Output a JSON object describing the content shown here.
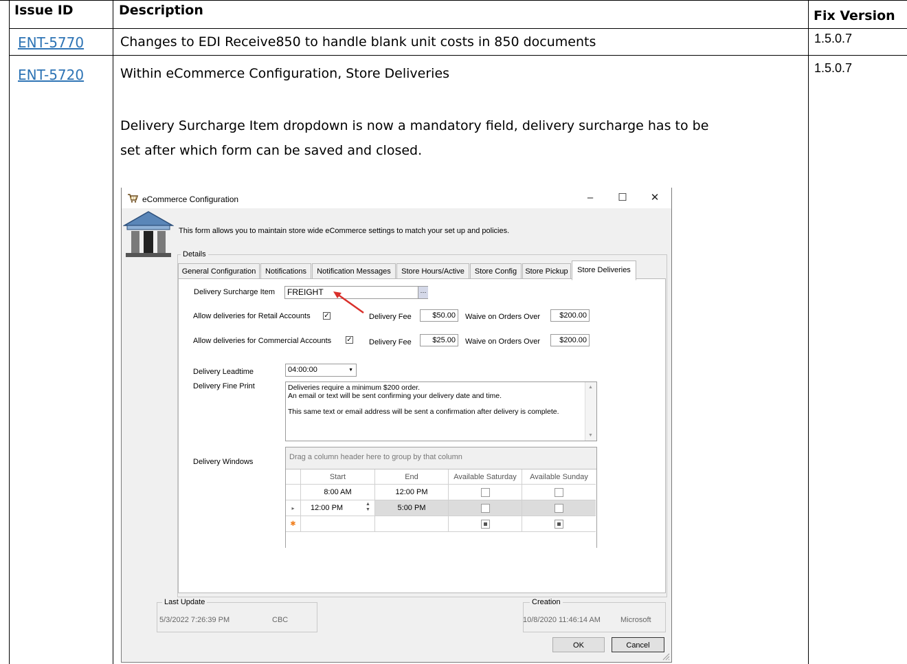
{
  "table": {
    "headers": {
      "issue": "Issue ID",
      "description": "Description",
      "fix": "Fix Version"
    },
    "rows": [
      {
        "issue": "ENT-5770",
        "description": "Changes to EDI Receive850 to handle blank unit costs in 850 documents",
        "fix": "1.5.0.7"
      },
      {
        "issue": "ENT-5720",
        "description_1": "Within eCommerce Configuration, Store Deliveries",
        "description_2": "Delivery Surcharge Item dropdown is now a mandatory field, delivery surcharge has to be",
        "description_3": "set after which form can be saved and closed.",
        "fix": "1.5.0.7"
      }
    ]
  },
  "dialog": {
    "title": "eCommerce Configuration",
    "controls": {
      "minimize": "–",
      "maximize": "☐",
      "close": "✕"
    },
    "intro": "This form allows you to maintain store wide eCommerce settings to match your set up and policies.",
    "details_label": "Details",
    "tabs": [
      "General Configuration",
      "Notifications",
      "Notification Messages",
      "Store Hours/Active",
      "Store Config",
      "Store Pickup",
      "Store Deliveries"
    ],
    "surcharge_label": "Delivery Surcharge Item",
    "surcharge_value": "FREIGHT",
    "ellipsis": "···",
    "retail_label": "Allow deliveries for Retail Accounts",
    "retail_checked": "✓",
    "retail_fee_label": "Delivery Fee",
    "retail_fee": "$50.00",
    "retail_waive_label": "Waive on Orders Over",
    "retail_waive": "$200.00",
    "commercial_label": "Allow deliveries for Commercial Accounts",
    "commercial_checked": "✓",
    "commercial_fee_label": "Delivery Fee",
    "commercial_fee": "$25.00",
    "commercial_waive_label": "Waive on Orders Over",
    "commercial_waive": "$200.00",
    "leadtime_label": "Delivery Leadtime",
    "leadtime_value": "04:00:00",
    "fineprint_label": "Delivery Fine Print",
    "fineprint_line1": "Deliveries require a minimum $200 order.",
    "fineprint_line2": "An email or text will be sent confirming your delivery date and time.",
    "fineprint_line3": "This same text or email address will be sent a confirmation after delivery is complete.",
    "windows_label": "Delivery Windows",
    "grid_group_hint": "Drag a column header here to group by that column",
    "grid_headers": [
      "Start",
      "End",
      "Available Saturday",
      "Available Sunday"
    ],
    "grid_rows": [
      {
        "start": "8:00 AM",
        "end": "12:00 PM"
      },
      {
        "start": "12:00 PM",
        "end": "5:00 PM"
      }
    ],
    "row_pointer": "▸",
    "new_row_marker": "✱",
    "last_update_label": "Last Update",
    "last_update_date": "5/3/2022 7:26:39 PM",
    "last_update_user": "CBC",
    "creation_label": "Creation",
    "creation_date": "10/8/2020 11:46:14 AM",
    "creation_user": "Microsoft",
    "ok": "OK",
    "cancel": "Cancel"
  }
}
